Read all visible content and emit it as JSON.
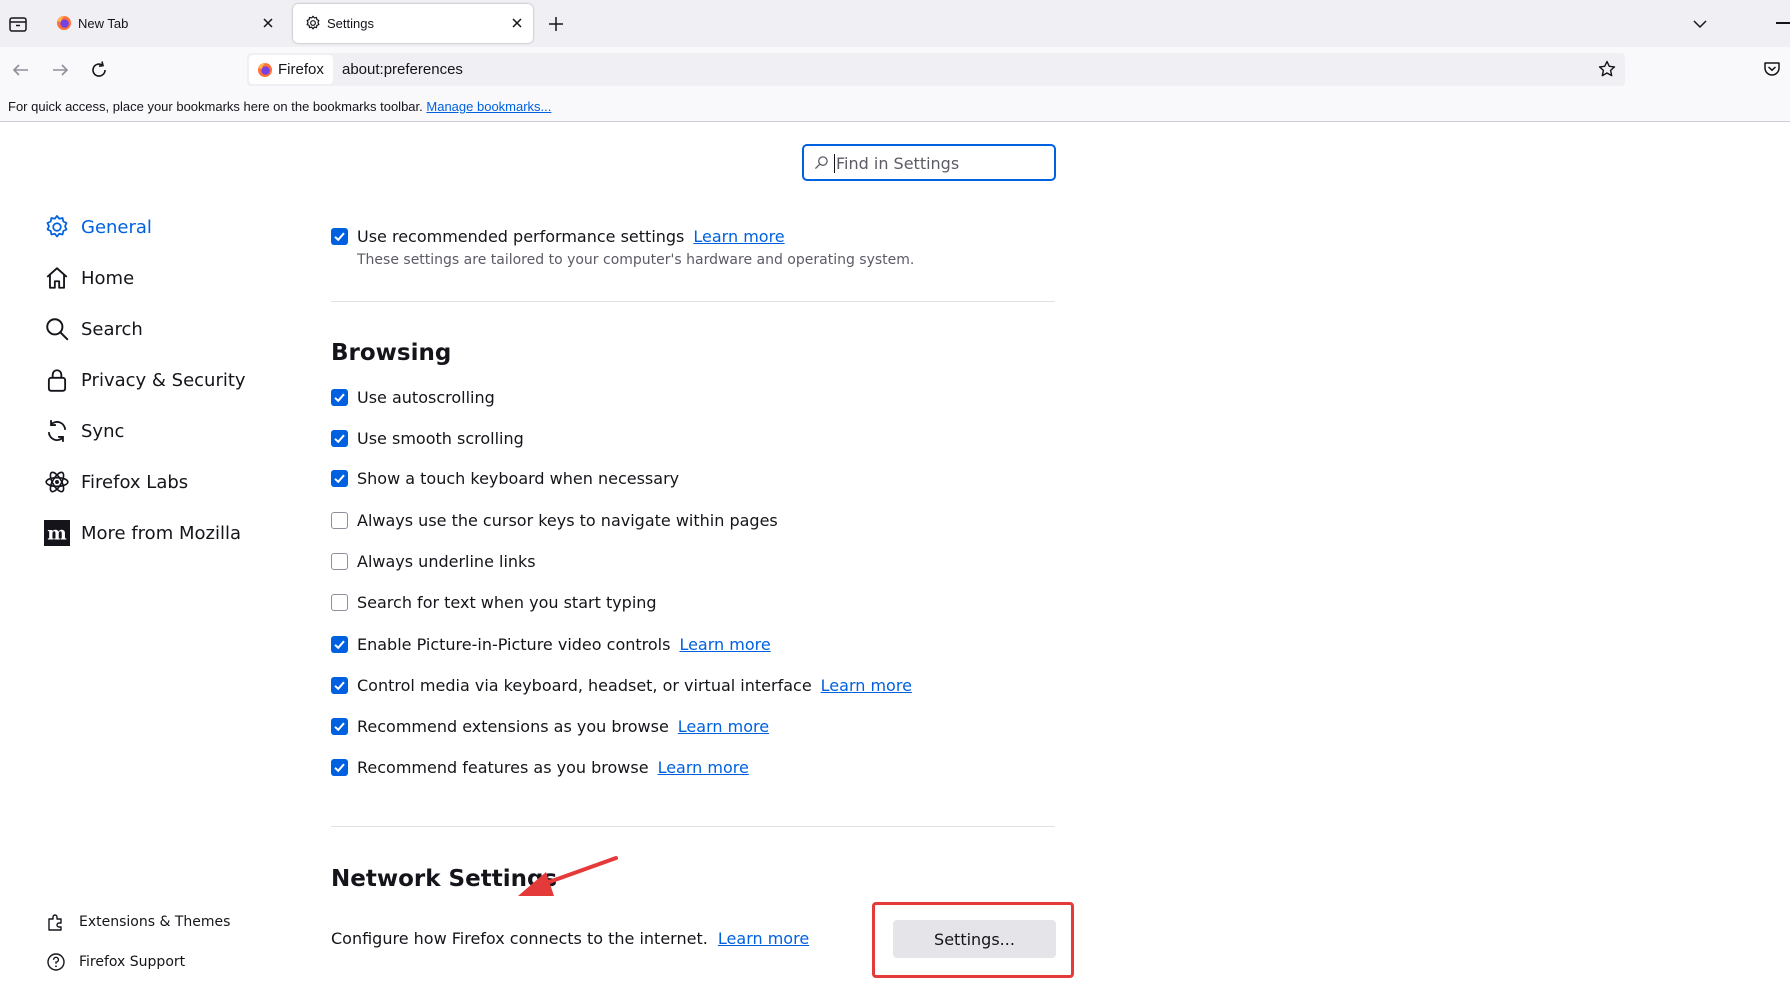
{
  "tabs": [
    {
      "title": "New Tab",
      "active": false
    },
    {
      "title": "Settings",
      "active": true
    }
  ],
  "urlbar": {
    "identity_label": "Firefox",
    "url": "about:preferences"
  },
  "bookmarks_bar": {
    "message": "For quick access, place your bookmarks here on the bookmarks toolbar.",
    "manage_link": "Manage bookmarks..."
  },
  "search": {
    "placeholder": "Find in Settings"
  },
  "sidebar": {
    "categories": [
      {
        "label": "General",
        "icon": "gear-icon",
        "selected": true
      },
      {
        "label": "Home",
        "icon": "home-icon",
        "selected": false
      },
      {
        "label": "Search",
        "icon": "search-icon",
        "selected": false
      },
      {
        "label": "Privacy & Security",
        "icon": "lock-icon",
        "selected": false
      },
      {
        "label": "Sync",
        "icon": "sync-icon",
        "selected": false
      },
      {
        "label": "Firefox Labs",
        "icon": "atom-icon",
        "selected": false
      },
      {
        "label": "More from Mozilla",
        "icon": "mozilla-icon",
        "selected": false
      }
    ],
    "footer": [
      {
        "label": "Extensions & Themes",
        "icon": "puzzle-icon"
      },
      {
        "label": "Firefox Support",
        "icon": "help-icon"
      }
    ]
  },
  "performance": {
    "label": "Use recommended performance settings",
    "checked": true,
    "learn_more": "Learn more",
    "description": "These settings are tailored to your computer's hardware and operating system."
  },
  "browsing": {
    "heading": "Browsing",
    "options": [
      {
        "label": "Use autoscrolling",
        "checked": true
      },
      {
        "label": "Use smooth scrolling",
        "checked": true
      },
      {
        "label": "Show a touch keyboard when necessary",
        "checked": true
      },
      {
        "label": "Always use the cursor keys to navigate within pages",
        "checked": false
      },
      {
        "label": "Always underline links",
        "checked": false
      },
      {
        "label": "Search for text when you start typing",
        "checked": false
      },
      {
        "label": "Enable Picture-in-Picture video controls",
        "checked": true,
        "learn_more": "Learn more"
      },
      {
        "label": "Control media via keyboard, headset, or virtual interface",
        "checked": true,
        "learn_more": "Learn more"
      },
      {
        "label": "Recommend extensions as you browse",
        "checked": true,
        "learn_more": "Learn more"
      },
      {
        "label": "Recommend features as you browse",
        "checked": true,
        "learn_more": "Learn more"
      }
    ]
  },
  "network": {
    "heading": "Network Settings",
    "description": "Configure how Firefox connects to the internet.",
    "learn_more": "Learn more",
    "button_label": "Settings..."
  },
  "colors": {
    "accent": "#0061e0",
    "annotation": "#e53a3a"
  }
}
